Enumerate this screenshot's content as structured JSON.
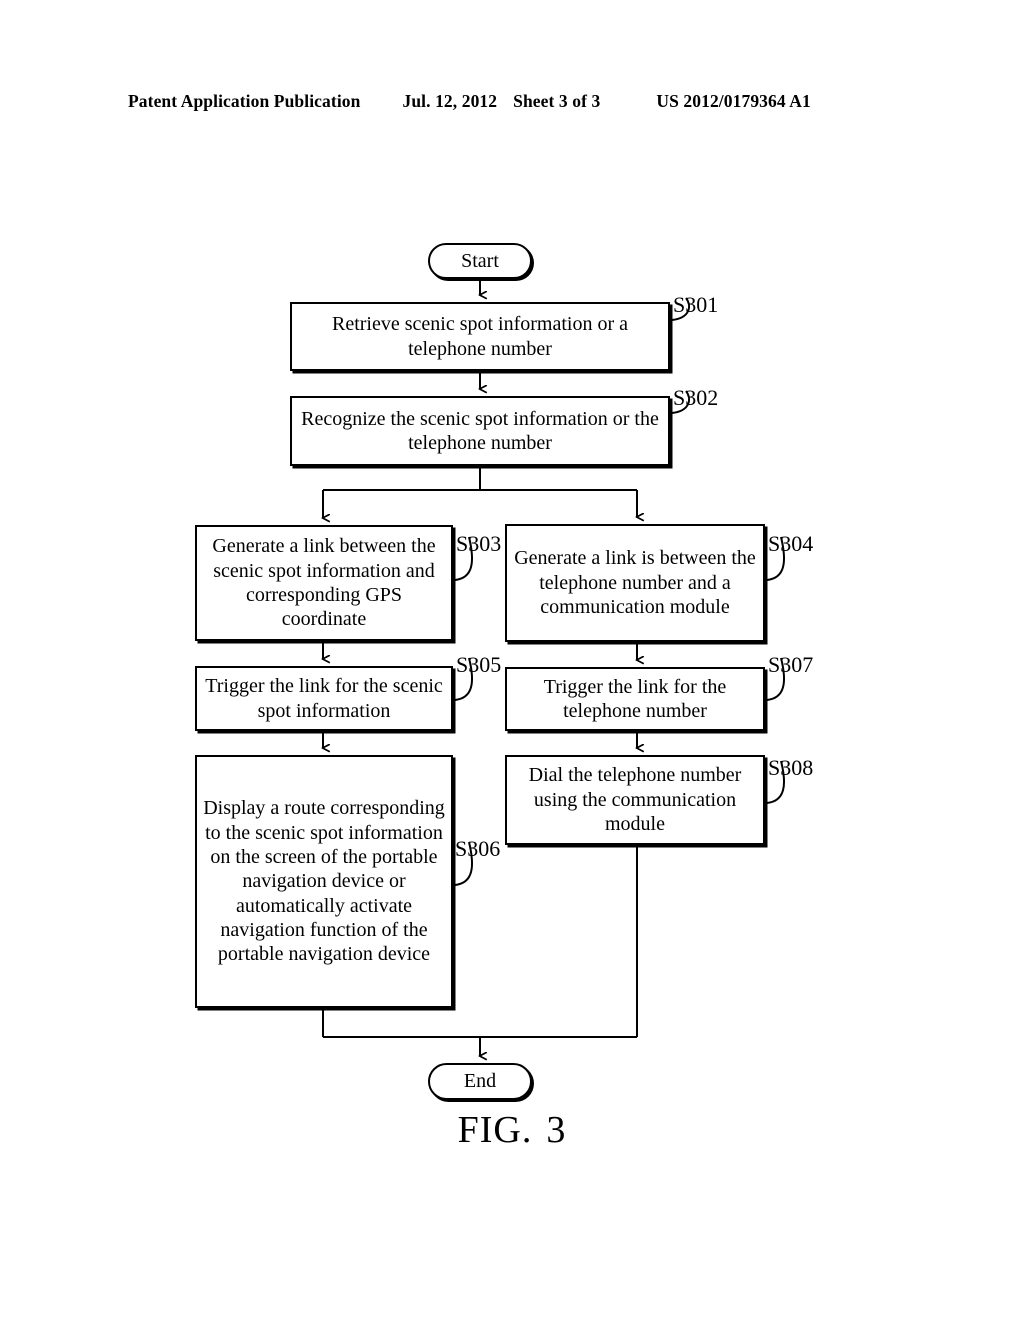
{
  "header": {
    "publication": "Patent Application Publication",
    "date": "Jul. 12, 2012",
    "sheet": "Sheet 3 of 3",
    "patent_number": "US 2012/0179364 A1"
  },
  "figure": {
    "caption_word": "FIG.",
    "caption_number": "3"
  },
  "flowchart": {
    "start_label": "Start",
    "end_label": "End",
    "nodes": [
      {
        "id": "S301",
        "ref": "S301",
        "text": "Retrieve scenic spot information or a telephone number"
      },
      {
        "id": "S302",
        "ref": "S302",
        "text": "Recognize the scenic spot information or the telephone number"
      },
      {
        "id": "S303",
        "ref": "S303",
        "text": "Generate a link between the scenic spot information and corresponding GPS coordinate"
      },
      {
        "id": "S304",
        "ref": "S304",
        "text": "Generate a link is between the telephone number and a communication module"
      },
      {
        "id": "S305",
        "ref": "S305",
        "text": "Trigger the link for the scenic spot information"
      },
      {
        "id": "S307",
        "ref": "S307",
        "text": "Trigger the link for the telephone number"
      },
      {
        "id": "S306",
        "ref": "S306",
        "text": "Display a route corresponding to the scenic spot information on the screen of the portable navigation device or automatically activate navigation function of the portable navigation device"
      },
      {
        "id": "S308",
        "ref": "S308",
        "text": "Dial the telephone number using the communication module"
      }
    ]
  }
}
